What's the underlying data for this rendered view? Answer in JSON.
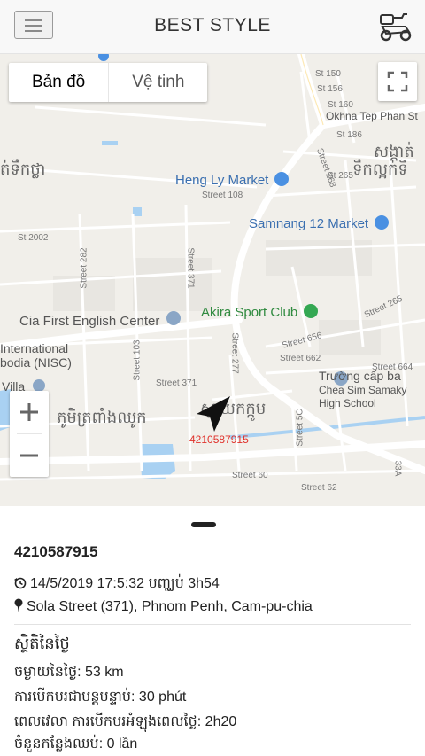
{
  "header": {
    "title": "BEST STYLE",
    "menu_icon": "hamburger-menu-icon",
    "logo_icon": "scooter-icon"
  },
  "map": {
    "type_tabs": [
      "Bản đồ",
      "Vệ tinh"
    ],
    "pois": {
      "heng_ly": "Heng Ly Market",
      "samnang": "Samnang 12 Market",
      "cia": "Cia First English Center",
      "akira": "Akira Sport Club",
      "truong_1": "Trường cấp ba",
      "truong_2": "Chea Sim Samaky",
      "truong_3": "High School",
      "intl_1": "International",
      "intl_2": "bodia (NISC)",
      "villa": "Villa",
      "okhna": "Okhna Tep Phan St"
    },
    "streets": {
      "s150": "St 150",
      "s156": "St 156",
      "s160": "St 160",
      "s186": "St 186",
      "s265": "St 265",
      "s268": "Street 268",
      "s108": "Street 108",
      "s2002": "St 2002",
      "s282": "Street 282",
      "s371a": "Street 371",
      "s265b": "Street 265",
      "s656": "Street 656",
      "s662": "Street 662",
      "s664": "Street 664",
      "s103": "Street 103",
      "s371b": "Street 371",
      "s277": "Street 277",
      "s5c": "Street 5C",
      "s60": "Street 60",
      "s62": "Street 62",
      "s33a": "33A"
    },
    "khmer": {
      "left_top": "ត់ទឹកថ្លា",
      "right_top_1": "សង្កាត់",
      "right_top_2": "ទឹកល្អក់ទី",
      "center_left": "ភូមិត្រពាំងឈូក",
      "center_right": "ស្វាយកក្កូម"
    },
    "vehicle_label": "4210587915",
    "controls": {
      "zoom_in": "+",
      "zoom_out": "−"
    }
  },
  "details": {
    "plate": "4210587915",
    "time_line": "14/5/2019 17:5:32 បញ្ឈប់ 3h54",
    "address": "Sola Street (371), Phnom Penh, Cam-pu-chia",
    "stats_title": "ស្ថិតិនៃថ្ងៃ",
    "distance": "ចម្ងាយនៃថ្ងៃ: 53 km",
    "continuous": "ការបើកបរជាបន្តបន្ទាប់: 30 phút",
    "total_time": "ពេលវេលា ការបើកបរអំឡុងពេលថ្ងៃ: 2h20",
    "stops": "ចំនួនកន្លែងឈប់: 0 lần"
  }
}
